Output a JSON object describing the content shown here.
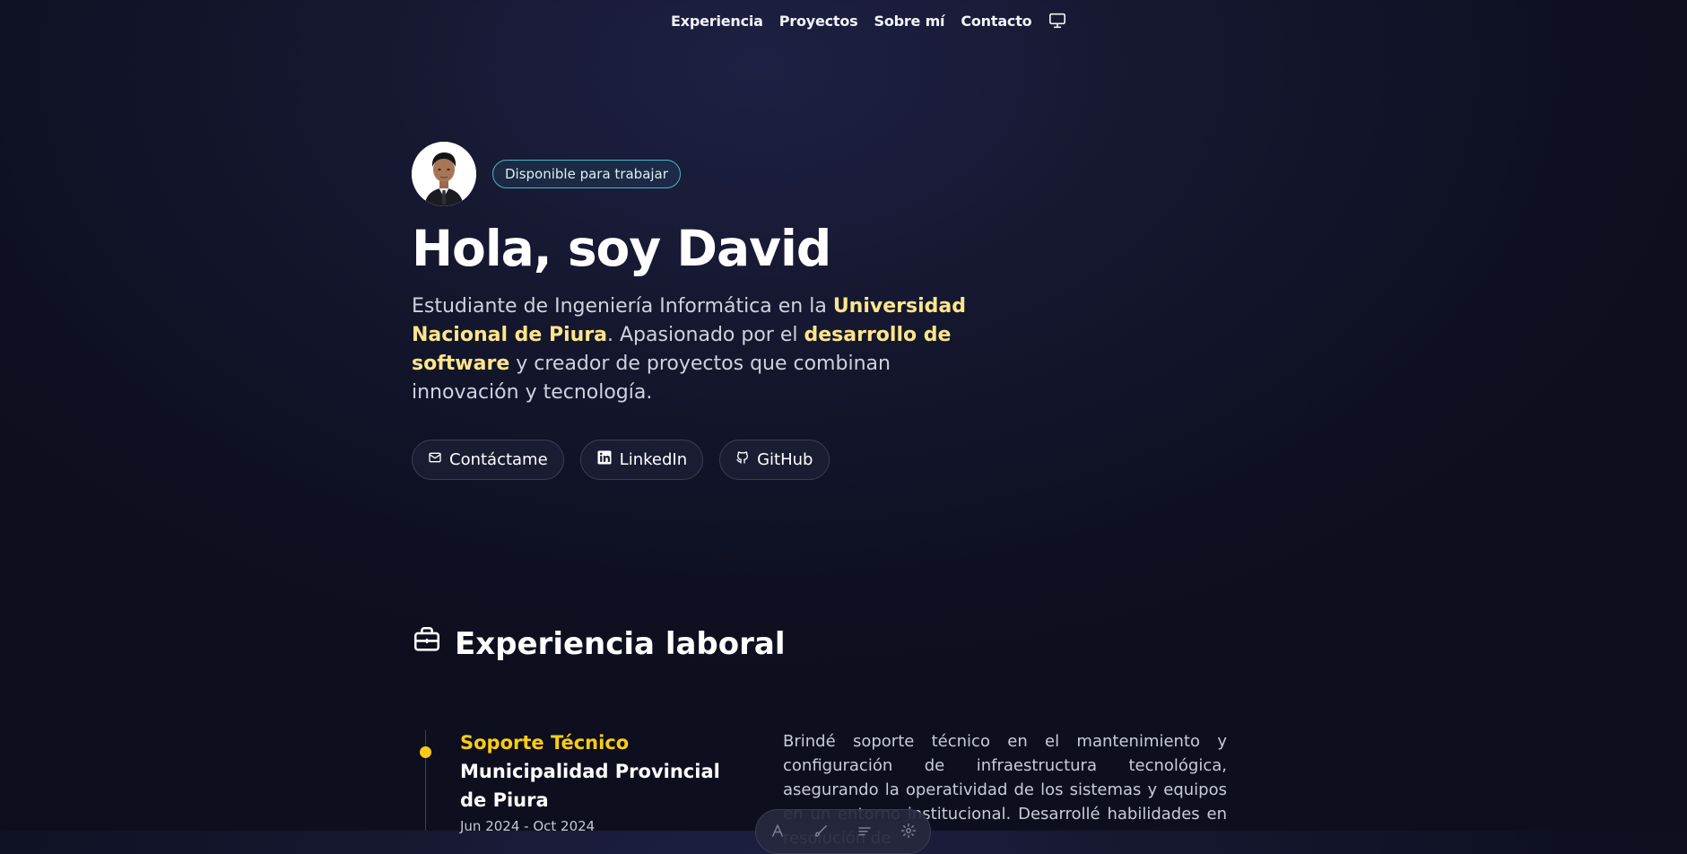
{
  "nav": {
    "items": [
      {
        "label": "Experiencia"
      },
      {
        "label": "Proyectos"
      },
      {
        "label": "Sobre mí"
      },
      {
        "label": "Contacto"
      }
    ],
    "theme_icon": "monitor-icon"
  },
  "hero": {
    "badge": "Disponible para trabajar",
    "title": "Hola, soy David",
    "description": {
      "part1": "Estudiante de Ingeniería Informática en la ",
      "highlight1": "Universidad Nacional de Piura",
      "part2": ". Apasionado por el ",
      "highlight2": "desarrollo de software",
      "part3": " y creador de proyectos que combinan innovación y tecnología."
    },
    "actions": [
      {
        "label": "Contáctame",
        "icon": "mail-icon"
      },
      {
        "label": "LinkedIn",
        "icon": "linkedin-icon"
      },
      {
        "label": "GitHub",
        "icon": "github-icon"
      }
    ]
  },
  "experience": {
    "title": "Experiencia laboral",
    "icon": "briefcase-icon",
    "jobs": [
      {
        "role": "Soporte Técnico",
        "company": "Municipalidad Provincial de Piura",
        "dates": "Jun 2024 - Oct 2024",
        "description": "Brindé soporte técnico en el mantenimiento y configuración de infraestructura tecnológica, asegurando la operatividad de los sistemas y equipos en un entorno institucional. Desarrollé habilidades en resolución de"
      }
    ]
  },
  "colors": {
    "accent_yellow": "#facc15",
    "highlight_yellow": "#fde68a",
    "badge_border": "#4ab8c8",
    "background": "#15172f"
  }
}
